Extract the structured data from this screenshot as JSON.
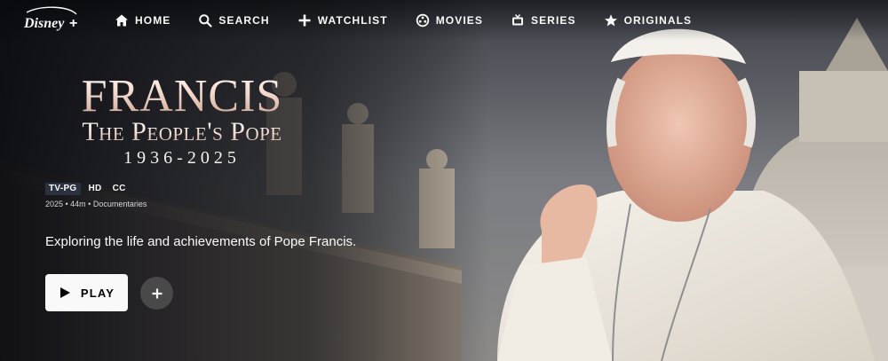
{
  "app": {
    "brand": "Disney+",
    "colors": {
      "background": "#0d0f15",
      "text": "#f9f9f9",
      "button": "#f9f9f9",
      "rating_badge": "#2c3140"
    }
  },
  "nav": {
    "items": [
      {
        "label": "HOME",
        "icon": "home-icon"
      },
      {
        "label": "SEARCH",
        "icon": "search-icon"
      },
      {
        "label": "WATCHLIST",
        "icon": "plus-icon"
      },
      {
        "label": "MOVIES",
        "icon": "film-reel-icon"
      },
      {
        "label": "SERIES",
        "icon": "tv-icon"
      },
      {
        "label": "ORIGINALS",
        "icon": "star-icon"
      }
    ]
  },
  "title": {
    "line1": "FRANCIS",
    "line2": "The People's Pope",
    "line3": "1936-2025"
  },
  "badges": [
    "TV-PG",
    "HD",
    "CC"
  ],
  "meta": "2025 • 44m • Documentaries",
  "description": "Exploring the life and achievements of Pope Francis.",
  "actions": {
    "play_label": "PLAY",
    "play_icon": "play-icon",
    "add_icon": "plus-icon"
  }
}
